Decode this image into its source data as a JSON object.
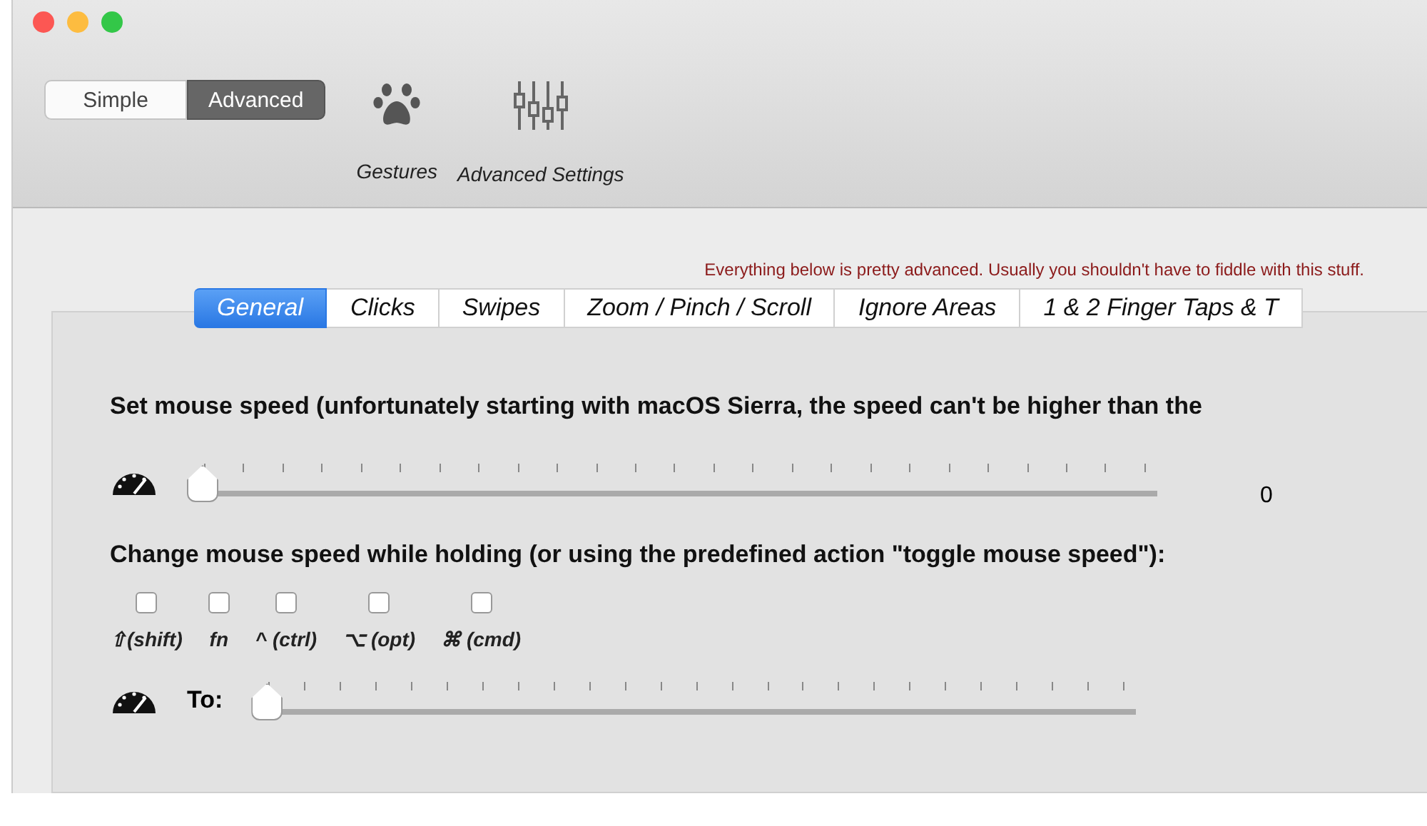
{
  "mode_switch": [
    {
      "label": "Simple",
      "selected": false
    },
    {
      "label": "Advanced",
      "selected": true
    }
  ],
  "toolbar": [
    {
      "label": "Gestures",
      "kind": "paw"
    },
    {
      "label": "Advanced Settings",
      "kind": "sliders"
    }
  ],
  "notice": "Everything below is pretty advanced. Usually you shouldn't have to fiddle with this stuff.",
  "tabs": [
    {
      "label": "General",
      "selected": true
    },
    {
      "label": "Clicks",
      "selected": false
    },
    {
      "label": "Swipes",
      "selected": false
    },
    {
      "label": "Zoom / Pinch / Scroll",
      "selected": false
    },
    {
      "label": "Ignore Areas",
      "selected": false
    },
    {
      "label": "1 & 2 Finger Taps & T",
      "selected": false
    }
  ],
  "speed": {
    "heading": "Set mouse speed (unfortunately starting with macOS Sierra, the speed can't be higher than the",
    "level": 0,
    "reading": "0"
  },
  "hold": {
    "heading": "Change mouse speed while holding (or using the predefined action \"toggle mouse speed\"):",
    "modifiers": [
      {
        "label": "⇧(shift)",
        "checked": false
      },
      {
        "label": "fn",
        "checked": false
      },
      {
        "label": "^ (ctrl)",
        "checked": false
      },
      {
        "label": "⌥ (opt)",
        "checked": false
      },
      {
        "label": "⌘ (cmd)",
        "checked": false
      }
    ],
    "to_label": "To:",
    "level": 0
  }
}
